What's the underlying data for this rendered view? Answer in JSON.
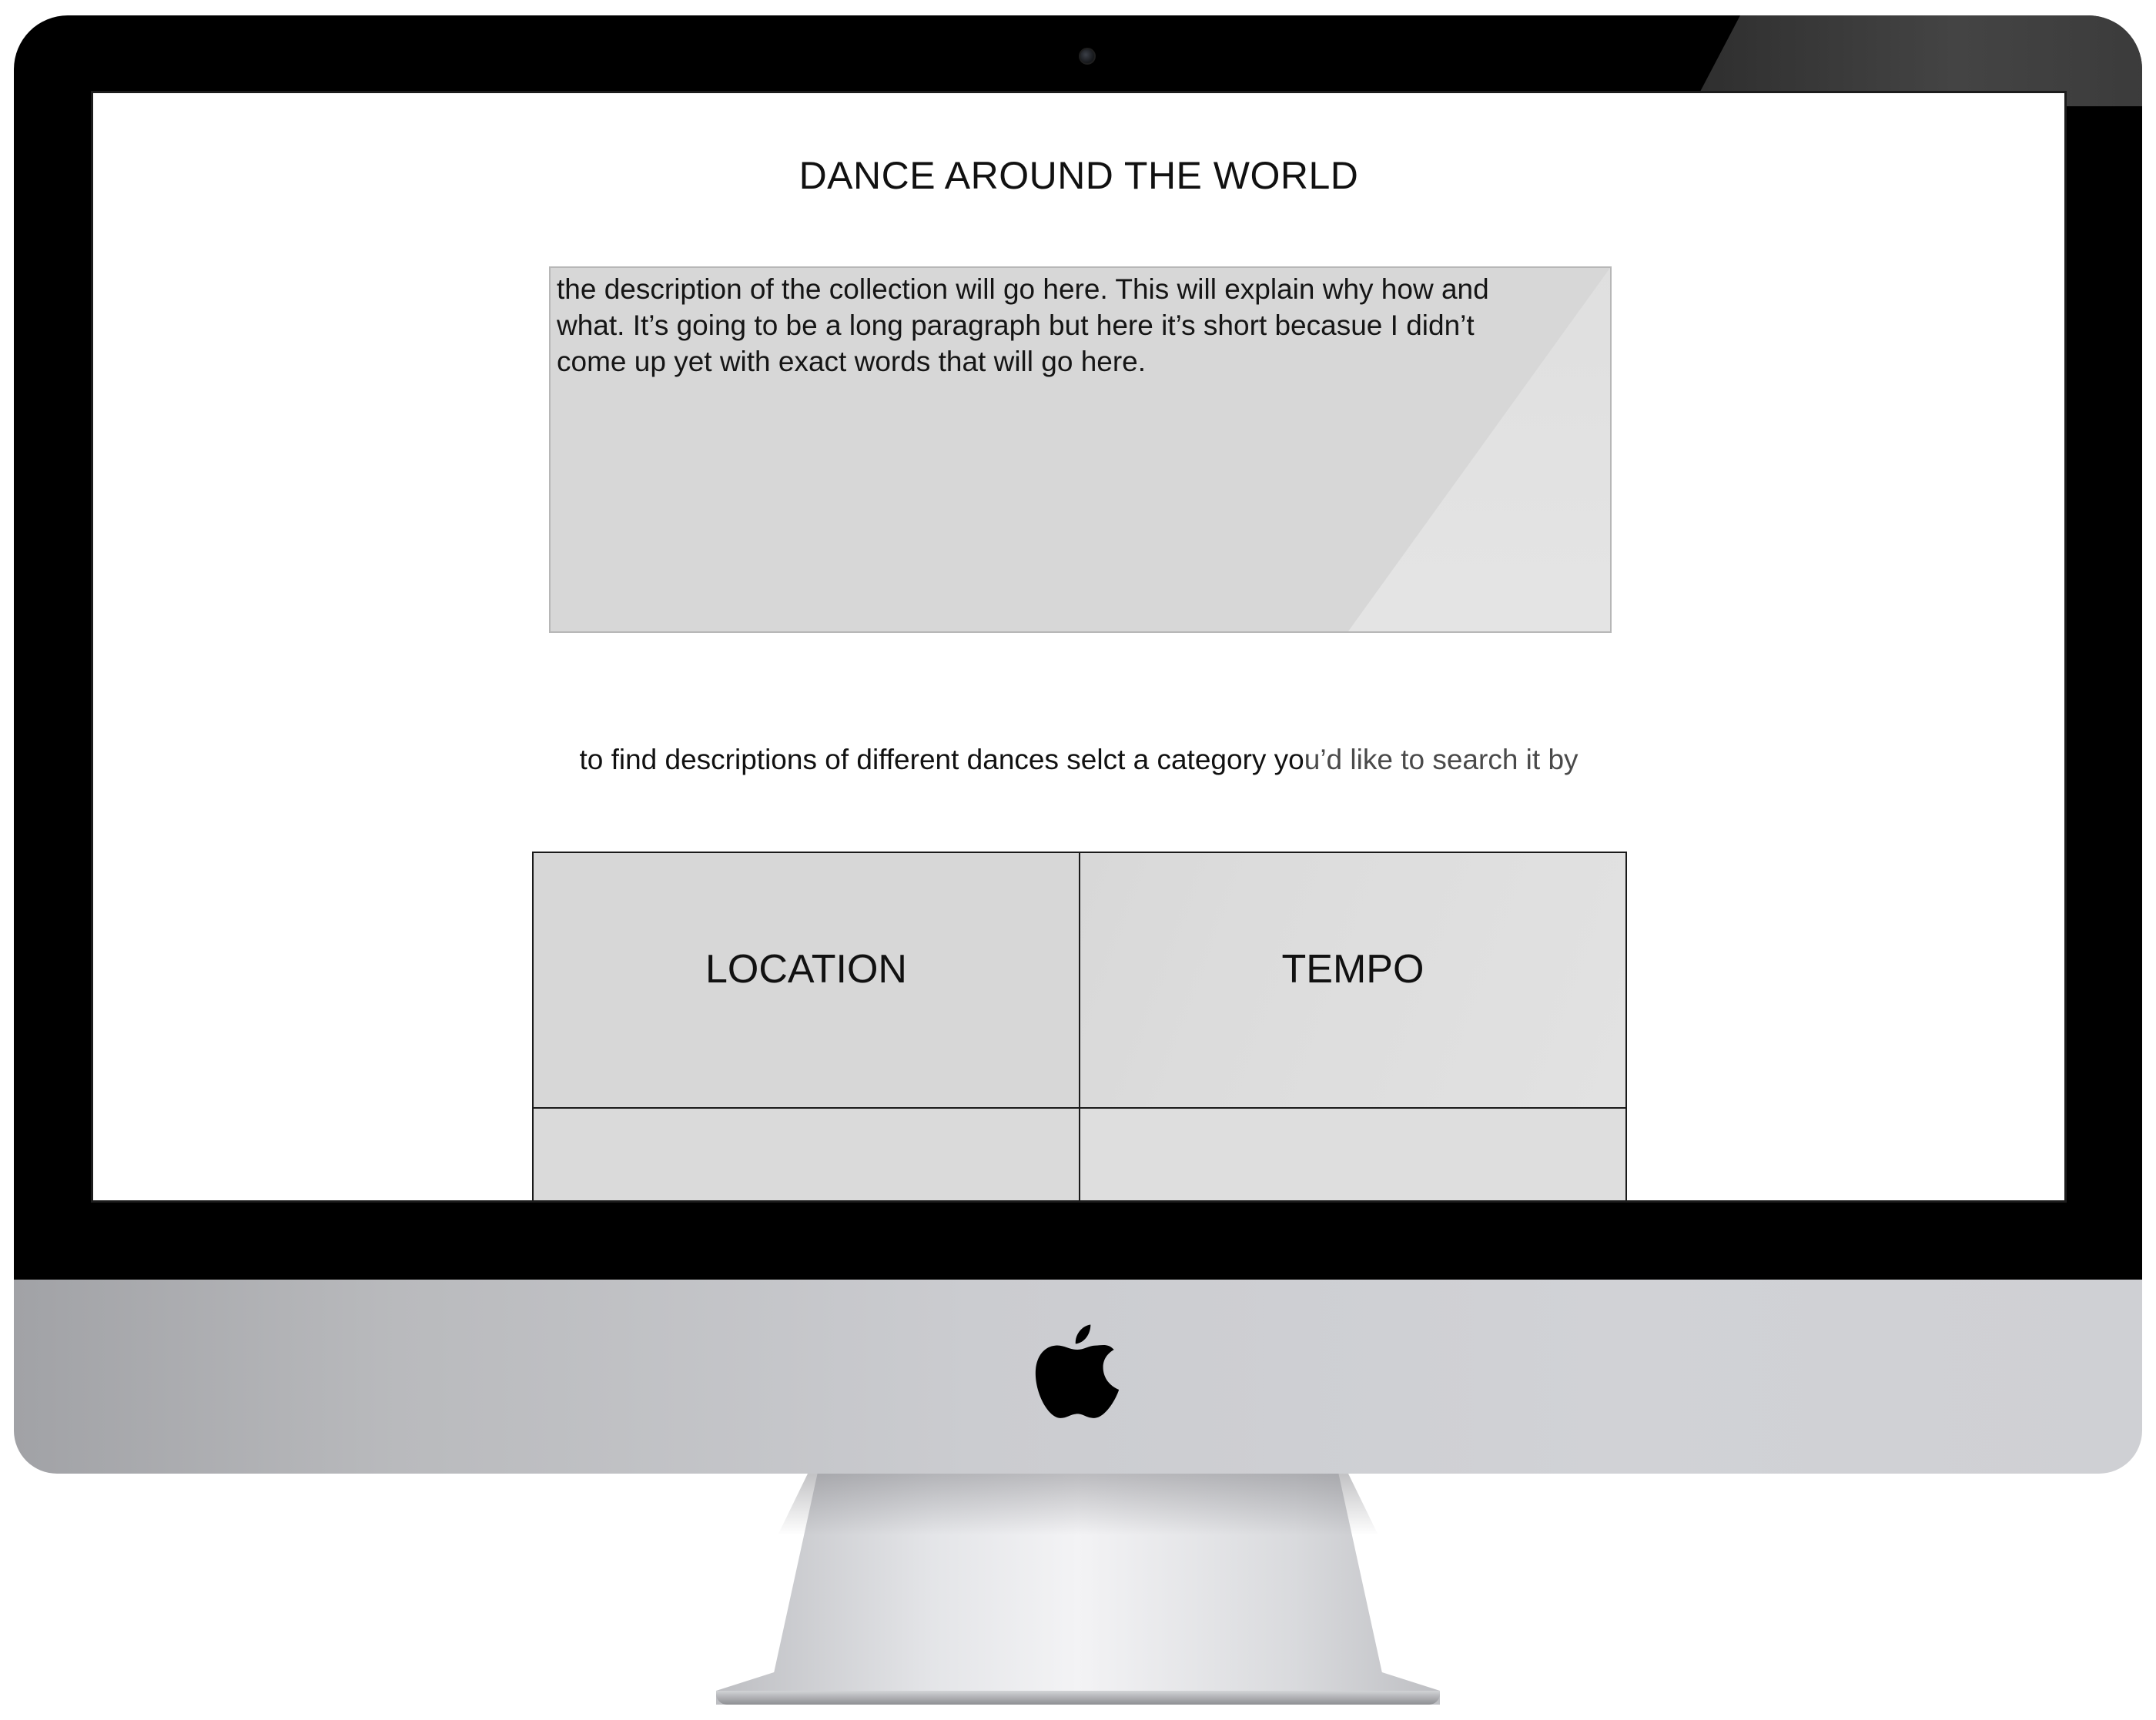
{
  "page": {
    "title": "DANCE AROUND THE WORLD",
    "description": "the description of the collection will go here. This will explain why how and what. It’s going to be a long paragraph but here it’s short becasue I didn’t come up yet with exact words that will go here.",
    "instruction_main": "to find descriptions of different dances selct a category yo",
    "instruction_tail": "u’d like to search it by"
  },
  "categories": [
    {
      "label": "LOCATION"
    },
    {
      "label": "TEMPO"
    },
    {
      "label": ""
    },
    {
      "label": ""
    }
  ],
  "colors": {
    "bezel": "#000000",
    "panel": "#d7d7d7",
    "text": "#111111",
    "chin": "#cbccd0"
  },
  "icons": {
    "camera": "camera-icon",
    "logo": "apple-logo-icon"
  }
}
